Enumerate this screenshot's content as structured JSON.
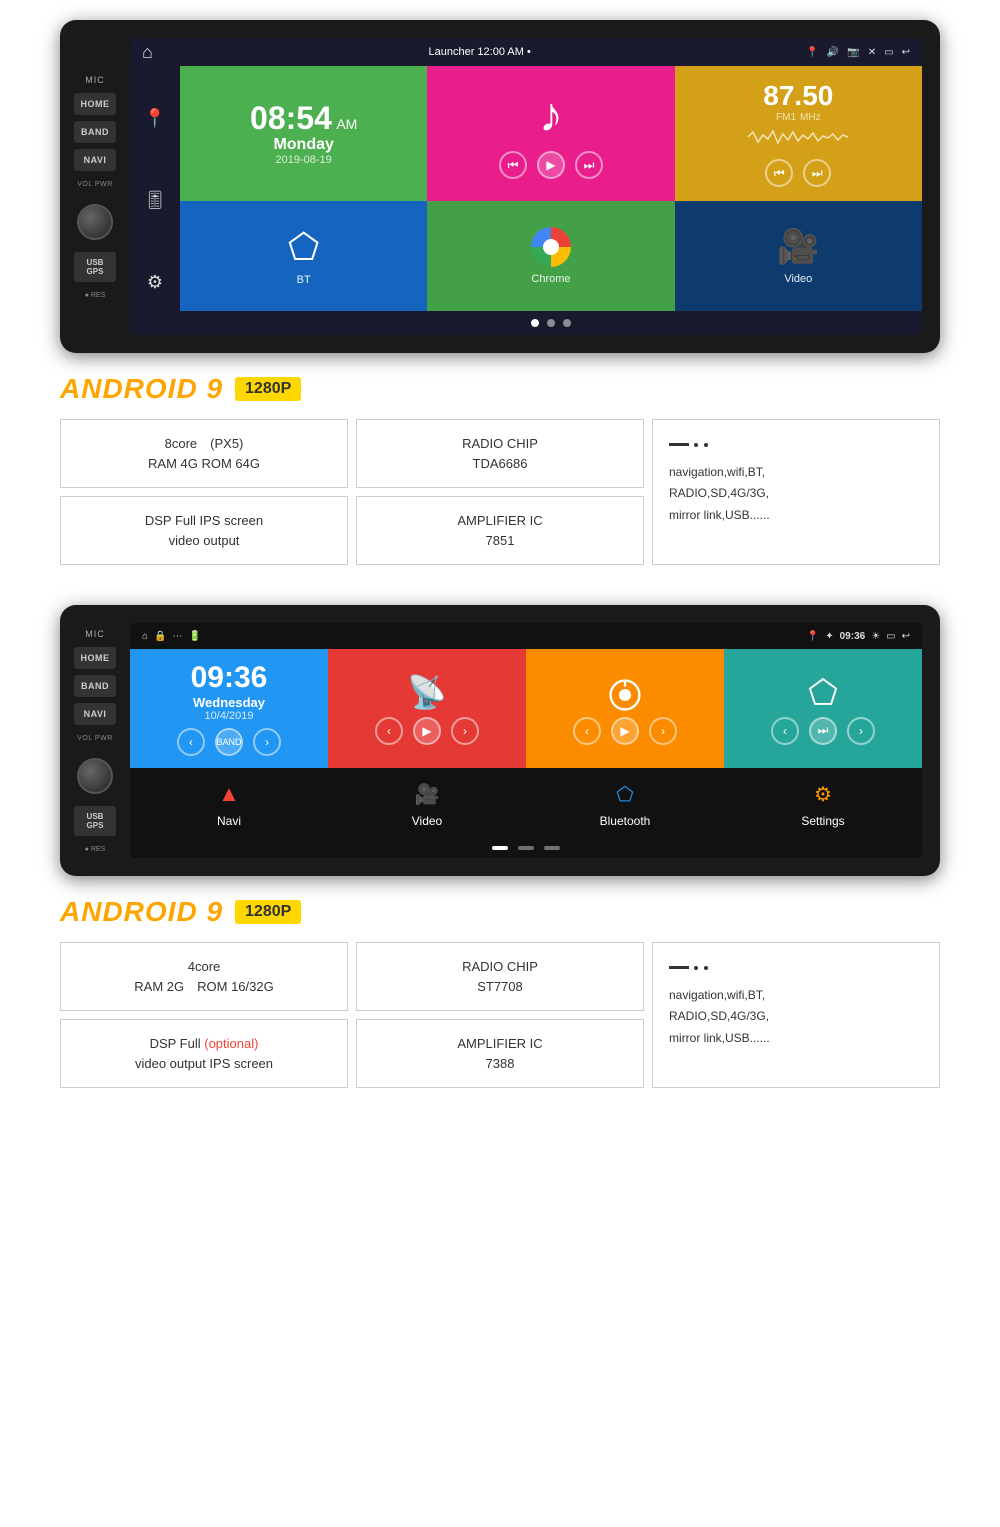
{
  "device1": {
    "status_bar": {
      "launcher_text": "Launcher  12:00 AM  •",
      "home_icon": "⌂"
    },
    "screen": {
      "time": "08:54",
      "time_suffix": "AM",
      "day": "Monday",
      "date": "2019-08-19",
      "radio_freq": "87.50",
      "radio_band": "FM1",
      "radio_unit": "MHz",
      "bt_label": "BT",
      "chrome_label": "Chrome",
      "video_label": "Video"
    },
    "left_buttons": {
      "mic": "MIC",
      "home": "HOME",
      "band": "BAND",
      "navi": "NAVI",
      "vol_pwr": "VOL  PWR",
      "usb_gps": "USB\nGPS",
      "res": "● RES"
    }
  },
  "spec1": {
    "android_label": "ANDROID 9",
    "resolution": "1280P",
    "box1": "8core   (PX5)\nRAM 4G ROM 64G",
    "box2": "RADIO CHIP\nTDA6686",
    "box3_line1": "DSP Full IPS screen",
    "box3_line2": "video output",
    "box4_line1": "AMPLIFIER IC",
    "box4_line2": "7851",
    "features": "navigation,wifi,BT,\nRADIO,SD,4G/3G,\nmirror link,USB......"
  },
  "device2": {
    "status_bar": {
      "time": "09:36",
      "home_icon": "⌂"
    },
    "screen": {
      "time": "09:36",
      "day": "Wednesday",
      "date": "10/4/2019",
      "band_label": "BAND",
      "navi_label": "Navi",
      "video_label": "Video",
      "bt_label": "Bluetooth",
      "settings_label": "Settings"
    },
    "left_buttons": {
      "mic": "MIC",
      "home": "HOME",
      "band": "BAND",
      "navi": "NAVI",
      "vol_pwr": "VOL  PWR",
      "usb_gps": "USB\nGPS",
      "res": "● RES"
    }
  },
  "spec2": {
    "android_label": "ANDROID 9",
    "resolution": "1280P",
    "box1_line1": "4core",
    "box1_line2": "RAM 2G  ROM 16/32G",
    "box2": "RADIO CHIP\nST7708",
    "box3_line1": "DSP Full",
    "box3_optional": "(optional)",
    "box3_line2": "video output IPS screen",
    "box4_line1": "AMPLIFIER IC",
    "box4_line2": "7388",
    "features": "navigation,wifi,BT,\nRADIO,SD,4G/3G,\nmirror link,USB......"
  }
}
